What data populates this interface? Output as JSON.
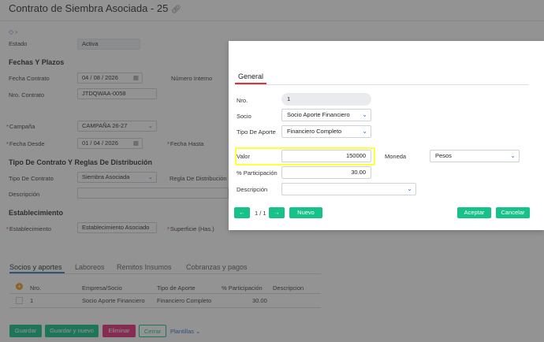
{
  "form": {
    "title": "Contrato de Siembra Asociada - 25",
    "estado_label": "Estado",
    "estado_value": "Activa",
    "fechas_section": "Fechas Y Plazos",
    "fecha_contrato_label": "Fecha Contrato",
    "fecha_contrato_value": "04 / 08 / 2026",
    "numero_interno_label": "Número Interno",
    "nro_contrato_label": "Nro. Contrato",
    "nro_contrato_value": "JTDQWAA-0058",
    "campana_label": "Campaña",
    "campana_value": "CAMPAÑA 26-27",
    "fecha_desde_label": "Fecha Desde",
    "fecha_desde_value": "01 / 04 / 2026",
    "fecha_hasta_label": "Fecha Hasta",
    "tipo_section": "Tipo De Contrato Y Reglas De Distribución",
    "tipo_contrato_label": "Tipo De Contrato",
    "tipo_contrato_value": "Siembra Asociada",
    "regla_label": "Regla De Distribución",
    "descripcion_label": "Descripción",
    "establecimiento_section": "Establecimiento",
    "establecimiento_label": "Establecimiento",
    "establecimiento_value": "Establecimiento Asociado",
    "superficie_label": "Superficie (Has.)"
  },
  "bottom_tabs": [
    "Socios y aportes",
    "Laboreos",
    "Remitos Insumos",
    "Cobranzas y pagos"
  ],
  "socios_table": {
    "headers": [
      "Nro.",
      "Empresa/Socio",
      "Tipo de Aporte",
      "% Participación",
      "Descripcion"
    ],
    "rows": [
      [
        "1",
        "Socio Aporte Financiero",
        "Financiero Completo",
        "30.00",
        ""
      ]
    ]
  },
  "bottom_buttons": {
    "guardar": "Guardar",
    "guardar_nuevo": "Guardar y nuevo",
    "eliminar": "Eliminar",
    "cerrar": "Cerrar",
    "plantillas": "Plantillas"
  },
  "modal": {
    "tab": "General",
    "nro_label": "Nro.",
    "nro_value": "1",
    "socio_label": "Socio",
    "socio_value": "Socio Aporte Financiero",
    "tipo_aporte_label": "Tipo De Aporte",
    "tipo_aporte_value": "Financiero Completo",
    "valor_label": "Valor",
    "valor_value": "150000",
    "moneda_label": "Moneda",
    "moneda_value": "Pesos",
    "participacion_label": "% Participación",
    "participacion_value": "30.00",
    "descripcion_label": "Descripción",
    "pager": "1 / 1",
    "nuevo": "Nuevo",
    "aceptar": "Aceptar",
    "cancelar": "Cancelar"
  },
  "colors": {
    "accent_green": "#16c28a",
    "tab_red": "#e0303a",
    "highlight": "#ffff3a",
    "danger": "#e0307a"
  }
}
